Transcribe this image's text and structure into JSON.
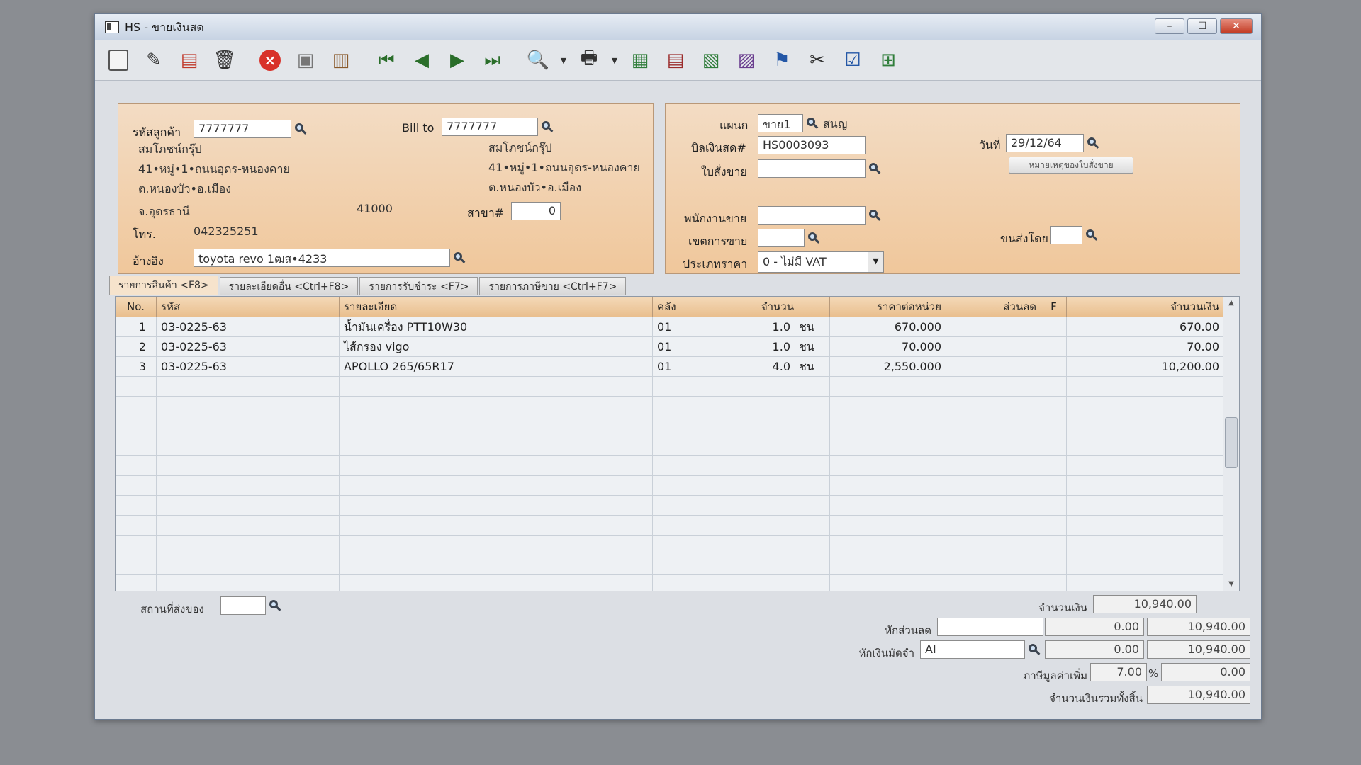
{
  "window": {
    "title": "HS - ขายเงินสด",
    "controls": {
      "minimize": "–",
      "maximize": "☐",
      "close": "✕"
    }
  },
  "toolbar": {
    "buttons": [
      {
        "name": "new-doc-icon"
      },
      {
        "name": "edit-doc-icon"
      },
      {
        "name": "void-doc-icon"
      },
      {
        "name": "trash-icon"
      },
      {
        "name": "cancel-icon"
      },
      {
        "name": "save-icon"
      },
      {
        "name": "books-icon"
      },
      {
        "name": "first-record-icon"
      },
      {
        "name": "previous-record-icon"
      },
      {
        "name": "next-record-icon"
      },
      {
        "name": "last-record-icon"
      },
      {
        "name": "find-doc-icon"
      },
      {
        "name": "print-icon"
      },
      {
        "name": "calculator-icon"
      },
      {
        "name": "report-icon"
      },
      {
        "name": "chart-icon"
      },
      {
        "name": "approve-icon"
      },
      {
        "name": "scissors-icon"
      },
      {
        "name": "ok-icon"
      },
      {
        "name": "network-icon"
      }
    ]
  },
  "customer": {
    "code_label": "รหัสลูกค้า",
    "code": "7777777",
    "name": "สมโภชน์กรุ๊ป",
    "address1": "41•หมู่•1•ถนนอุดร-หนองคาย",
    "address2": "ต.หนองบัว•อ.เมือง",
    "province": "จ.อุดรธานี",
    "postcode": "41000",
    "phone_label": "โทร.",
    "phone": "042325251",
    "ref_label": "อ้างอิง",
    "ref": "toyota revo 1ฒส•4233"
  },
  "bill_to": {
    "label": "Bill to",
    "code": "7777777",
    "name": "สมโภชน์กรุ๊ป",
    "address1": "41•หมู่•1•ถนนอุดร-หนองคาย",
    "address2": "ต.หนองบัว•อ.เมือง",
    "branch_label": "สาขา#",
    "branch": "0"
  },
  "doc": {
    "dept_label": "แผนก",
    "dept_code": "ขาย1",
    "dept_name": "สนญ",
    "bill_label": "บิลเงินสด#",
    "bill_no": "HS0003093",
    "date_label": "วันที่",
    "date": "29/12/64",
    "order_label": "ใบสั่งขาย",
    "order": "",
    "order_note_button": "หมายเหตุของใบสั่งขาย",
    "sales_label": "พนักงานขาย",
    "sales": "",
    "area_label": "เขตการขาย",
    "area": "",
    "ship_label": "ขนส่งโดย",
    "ship": "",
    "price_type_label": "ประเภทราคา",
    "price_type": "0 - ไม่มี VAT"
  },
  "tabs": [
    {
      "label": "รายการสินค้า <F8>",
      "active": true
    },
    {
      "label": "รายละเอียดอื่น <Ctrl+F8>",
      "active": false
    },
    {
      "label": "รายการรับชำระ <F7>",
      "active": false
    },
    {
      "label": "รายการภาษีขาย <Ctrl+F7>",
      "active": false
    }
  ],
  "grid": {
    "headers": {
      "no": "No.",
      "code": "รหัส",
      "desc": "รายละเอียด",
      "wh": "คลัง",
      "qty": "จำนวน",
      "price": "ราคาต่อหน่วย",
      "discount": "ส่วนลด",
      "flag": "F",
      "amount": "จำนวนเงิน"
    },
    "rows": [
      {
        "no": "1",
        "code": "03-0225-63",
        "desc": "น้ำมันเครื่อง PTT10W30",
        "wh": "01",
        "qty": "1.0",
        "unit": "ชน",
        "price": "670.000",
        "discount": "",
        "flag": "",
        "amount": "670.00"
      },
      {
        "no": "2",
        "code": "03-0225-63",
        "desc": "ไส้กรอง vigo",
        "wh": "01",
        "qty": "1.0",
        "unit": "ชน",
        "price": "70.000",
        "discount": "",
        "flag": "",
        "amount": "70.00"
      },
      {
        "no": "3",
        "code": "03-0225-63",
        "desc": "APOLLO 265/65R17",
        "wh": "01",
        "qty": "4.0",
        "unit": "ชน",
        "price": "2,550.000",
        "discount": "",
        "flag": "",
        "amount": "10,200.00"
      }
    ]
  },
  "footer": {
    "ship_place_label": "สถานที่ส่งของ",
    "ship_place": "",
    "amount_label": "จำนวนเงิน",
    "amount": "10,940.00",
    "discount_label": "หักส่วนลด",
    "discount_text": "",
    "discount_value": "0.00",
    "after_discount": "10,940.00",
    "deposit_label": "หักเงินมัดจำ",
    "deposit_code": "AI",
    "deposit_value": "0.00",
    "after_deposit": "10,940.00",
    "vat_label": "ภาษีมูลค่าเพิ่ม",
    "vat_rate": "7.00",
    "vat_pct": "%",
    "vat_value": "0.00",
    "total_label": "จำนวนเงินรวมทั้งสิ้น",
    "total": "10,940.00"
  }
}
